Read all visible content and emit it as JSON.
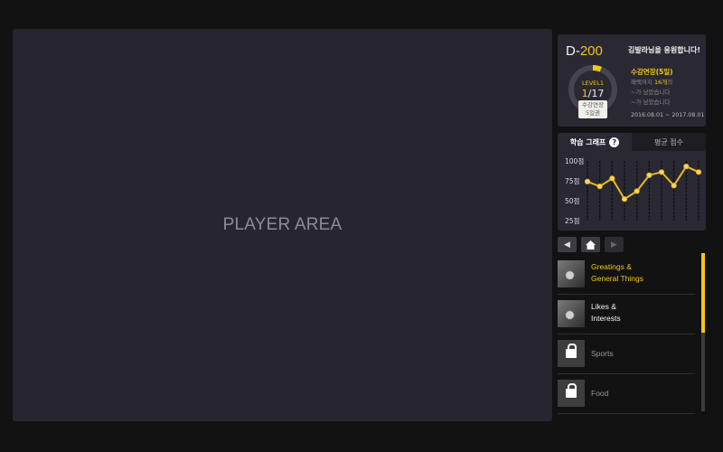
{
  "player": {
    "label": "PLAYER AREA"
  },
  "info": {
    "dday_prefix": "D-",
    "dday_number": "200",
    "cheer": "김발라님을 응원합니다!",
    "level_label": "LEVEL1",
    "progress_current": "1",
    "progress_total": "/17",
    "ticket_line1": "수강연장",
    "ticket_line2": "5일권",
    "extension_title": "수강연장(5일)",
    "line1_prefix": "해택까지 ",
    "line1_highlight": "16개",
    "line1_suffix": "의",
    "line2": "~가 남았습니다",
    "line3": "~가 남았습니다",
    "period": "2016.08.01 ~ 2017.08.01",
    "progress_ratio": 0.06
  },
  "graph": {
    "tab_active": "학습 그래프",
    "help_icon": "?",
    "tab_inactive": "평균 점수",
    "y_labels": [
      "100점",
      "75점",
      "50점",
      "25점"
    ]
  },
  "chart_data": {
    "type": "line",
    "values": [
      74,
      68,
      78,
      52,
      62,
      82,
      86,
      69,
      93,
      86
    ],
    "ylim": [
      25,
      100
    ],
    "yticks": [
      "100점",
      "75점",
      "50점",
      "25점"
    ],
    "line_color": "#e8b825"
  },
  "nav": {
    "prev_icon": "◀",
    "home_icon": "home",
    "next_icon": "▶"
  },
  "chapters": [
    {
      "line1": "Greatings &",
      "line2": "General Things",
      "locked": false,
      "active": true
    },
    {
      "line1": "Likes &",
      "line2": "Interests",
      "locked": false,
      "active": false
    },
    {
      "line1": "Sports",
      "line2": "",
      "locked": true,
      "active": false
    },
    {
      "line1": "Food",
      "line2": "",
      "locked": true,
      "active": false
    }
  ],
  "colors": {
    "accent": "#f5c518",
    "panel": "#2a2933",
    "background": "#121212"
  }
}
